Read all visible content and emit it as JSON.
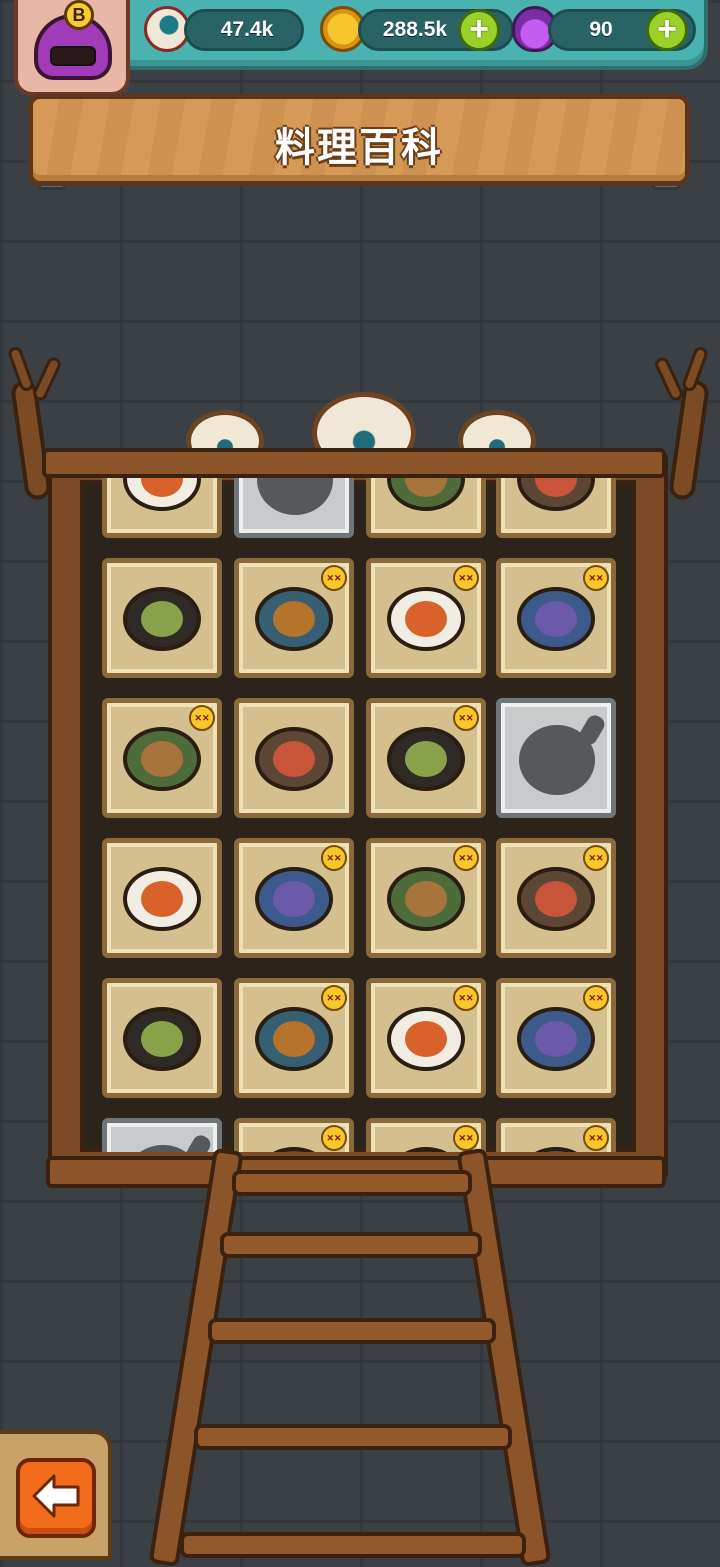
{
  "title": "料理百科",
  "resources": {
    "eyeballs": "47.4k",
    "coins": "288.5k",
    "potions": "90"
  },
  "avatar": {
    "rank": "B"
  },
  "icons": {
    "eyeball": "eyeball-currency-icon",
    "coin": "gold-coin-icon",
    "potion": "purple-potion-icon",
    "plus": "plus-icon",
    "back": "back-arrow-icon",
    "spicy": "spicy-monster-badge-icon"
  },
  "colors": {
    "hud": "#4ab2b0",
    "board": "#d59a56",
    "card": "#d4c08e",
    "locked_card": "#c8cbcc",
    "back_button": "#f26a1c"
  },
  "recipes": [
    {
      "status": "unlocked",
      "spicy": false
    },
    {
      "status": "locked",
      "spicy": false
    },
    {
      "status": "unlocked",
      "spicy": false
    },
    {
      "status": "unlocked",
      "spicy": false
    },
    {
      "status": "unlocked",
      "spicy": false
    },
    {
      "status": "unlocked",
      "spicy": true
    },
    {
      "status": "unlocked",
      "spicy": true
    },
    {
      "status": "unlocked",
      "spicy": true
    },
    {
      "status": "unlocked",
      "spicy": true
    },
    {
      "status": "unlocked",
      "spicy": false
    },
    {
      "status": "unlocked",
      "spicy": true
    },
    {
      "status": "locked",
      "spicy": false
    },
    {
      "status": "unlocked",
      "spicy": false
    },
    {
      "status": "unlocked",
      "spicy": true
    },
    {
      "status": "unlocked",
      "spicy": true
    },
    {
      "status": "unlocked",
      "spicy": true
    },
    {
      "status": "unlocked",
      "spicy": false
    },
    {
      "status": "unlocked",
      "spicy": true
    },
    {
      "status": "unlocked",
      "spicy": true
    },
    {
      "status": "unlocked",
      "spicy": true
    },
    {
      "status": "locked",
      "spicy": false
    },
    {
      "status": "unlocked",
      "spicy": true
    },
    {
      "status": "unlocked",
      "spicy": true
    },
    {
      "status": "unlocked",
      "spicy": true
    }
  ]
}
